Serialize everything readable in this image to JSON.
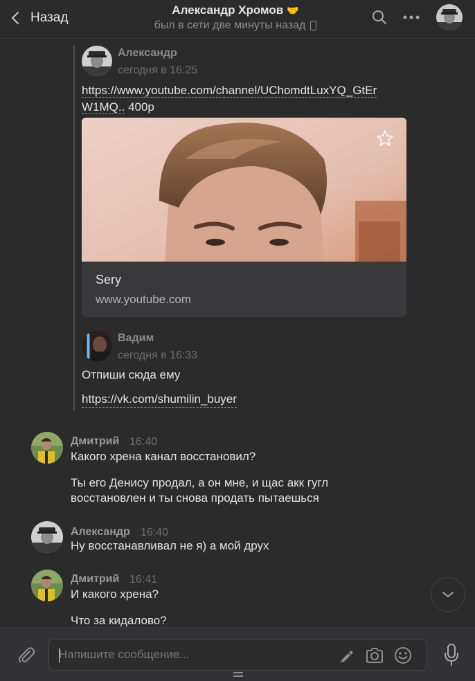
{
  "header": {
    "back_label": "Назад",
    "title": "Александр Хромов",
    "title_emoji": "🤝",
    "status": "был в сети две минуты назад"
  },
  "forwarded": {
    "first": {
      "author": "Александр",
      "time": "сегодня в 16:25",
      "link_line1": "https://www.youtube.com/channel/UChomdtLuxYQ_GtEr",
      "link_line2": "W1MQ..",
      "link_suffix": " 400р",
      "card": {
        "title": "Sery",
        "url": "www.youtube.com"
      }
    },
    "second": {
      "author": "Вадим",
      "time": "сегодня в 16:33",
      "text": "Отпиши сюда ему",
      "link": "https://vk.com/shumilin_buyer"
    }
  },
  "messages": [
    {
      "author": "Дмитрий",
      "time": "16:40",
      "lines": [
        "Какого хрена канал восстановил?",
        "Ты его Денису продал, а он мне, и щас акк гугл",
        "восстановлен и ты снова продать пытаешься"
      ]
    },
    {
      "author": "Александр",
      "time": "16:40",
      "lines": [
        "Ну восстанавливал не я) а мой друх"
      ]
    },
    {
      "author": "Дмитрий",
      "time": "16:41",
      "lines": [
        "И какого хрена?",
        "Что за кидалово?"
      ]
    }
  ],
  "composer": {
    "placeholder": "Напишите сообщение..."
  },
  "colors": {
    "background": "#2b2b2c",
    "text": "#e1e3e6",
    "muted": "#8d8d8f"
  }
}
